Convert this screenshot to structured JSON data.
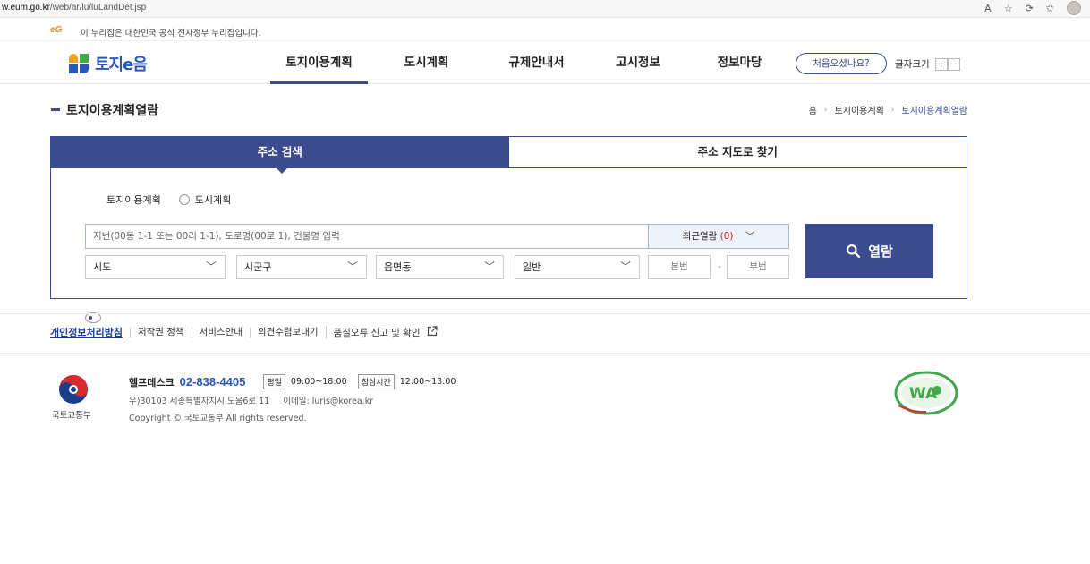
{
  "browser": {
    "url_prefix": "w.eum.go.kr",
    "url_path": "/web/ar/lu/luLandDet.jsp"
  },
  "gov_banner": {
    "logo_text": "eG",
    "text": "이 누리집은 대한민국 공식 전자정부 누리집입니다."
  },
  "header": {
    "logo_name": "토지e음",
    "nav": [
      {
        "label": "토지이용계획"
      },
      {
        "label": "도시계획"
      },
      {
        "label": "규제안내서"
      },
      {
        "label": "고시정보"
      },
      {
        "label": "정보마당"
      }
    ],
    "first_visit": "처음오셨나요?",
    "font_size_label": "글자크기",
    "plus": "+",
    "minus": "−"
  },
  "page": {
    "title": "토지이용계획열람",
    "breadcrumb": [
      "홈",
      "토지이용계획",
      "토지이용계획열람"
    ]
  },
  "search": {
    "tabs": [
      {
        "label": "주소 검색"
      },
      {
        "label": "주소 지도로 찾기"
      }
    ],
    "radios": [
      {
        "label": "토지이용계획"
      },
      {
        "label": "도시계획"
      }
    ],
    "address_placeholder": "지번(00동 1-1 또는 00리 1-1), 도로명(00로 1), 건물명 입력",
    "recent_label": "최근열람",
    "recent_count": "(0)",
    "selects": [
      {
        "label": "시도"
      },
      {
        "label": "시군구"
      },
      {
        "label": "읍면동"
      },
      {
        "label": "일반"
      }
    ],
    "main_no": "본번",
    "sub_no": "부번",
    "dash": "-",
    "button_label": "열람"
  },
  "footer": {
    "links": [
      "개인정보처리방침",
      "저작권 정책",
      "서비스안내",
      "의견수렴보내기",
      "품질오류 신고 및 확인"
    ],
    "ministry": "국토교통부",
    "helpdesk_label": "헬프데스크",
    "phone": "02-838-4405",
    "weekday_tag": "평일",
    "weekday_time": "09:00~18:00",
    "lunch_tag": "점심시간",
    "lunch_time": "12:00~13:00",
    "address": "우)30103 세종특별자치시 도움6로 11",
    "email": "이메일: luris@korea.kr",
    "copyright": "Copyright © 국토교통부 All rights reserved.",
    "wa_text": "WA"
  },
  "colors": {
    "primary": "#3c4a8e",
    "logo_blue": "#2a57b5",
    "accent_orange": "#e38b2a",
    "count_red": "#d4191d"
  }
}
